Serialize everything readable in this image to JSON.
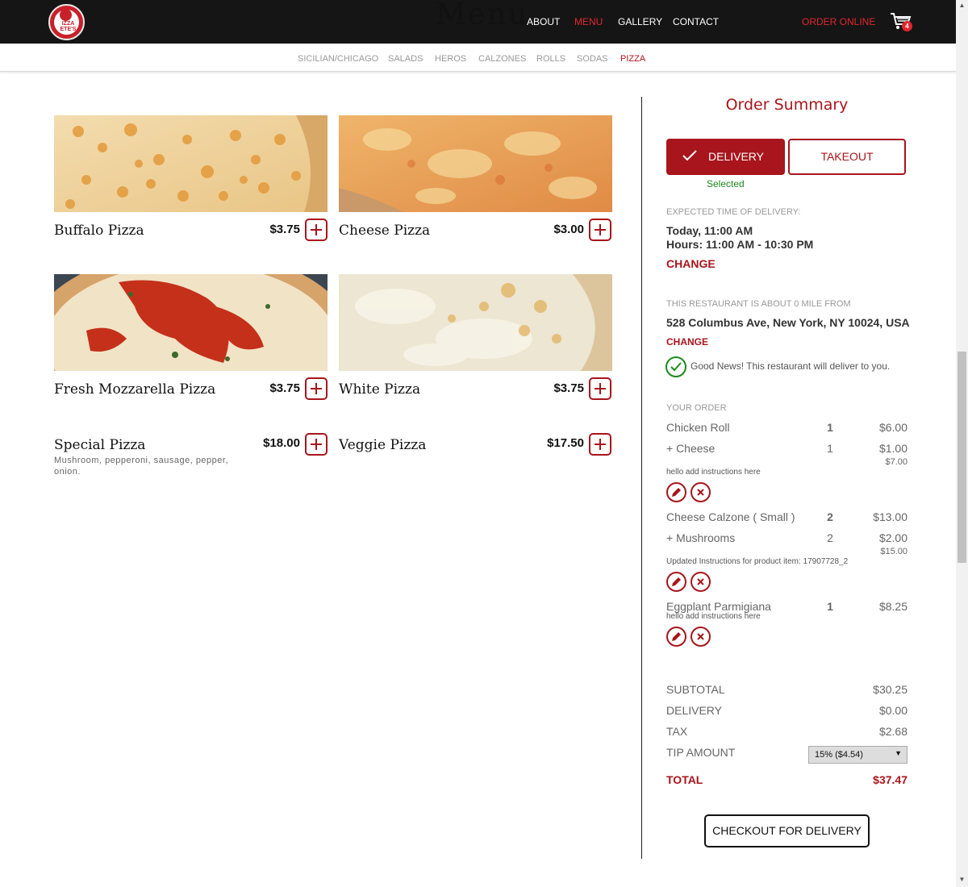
{
  "header": {
    "logo_text": "IZZA ETE'S",
    "page_title": "Menu",
    "nav": [
      "ABOUT",
      "MENU",
      "GALLERY",
      "CONTACT"
    ],
    "order_online": "ORDER ONLINE",
    "cart_count": "4"
  },
  "categories": [
    "SICILIAN/CHICAGO",
    "SALADS",
    "HEROS",
    "CALZONES",
    "ROLLS",
    "SODAS",
    "PIZZA"
  ],
  "active_category": "PIZZA",
  "products": [
    {
      "name": "Buffalo Pizza",
      "price": "$3.75"
    },
    {
      "name": "Cheese Pizza",
      "price": "$3.00"
    },
    {
      "name": "Fresh Mozzarella Pizza",
      "price": "$3.75"
    },
    {
      "name": "White Pizza",
      "price": "$3.75"
    },
    {
      "name": "Special Pizza",
      "price": "$18.00",
      "description": "Mushroom, pepperoni, sausage, pepper, onion."
    },
    {
      "name": "Veggie Pizza",
      "price": "$17.50"
    }
  ],
  "summary": {
    "title": "Order Summary",
    "delivery_label": "DELIVERY",
    "takeout_label": "TAKEOUT",
    "selected": "Selected",
    "expected_label": "EXPECTED TIME OF DELIVERY:",
    "expected_time": "Today, 11:00 AM",
    "hours": "Hours: 11:00 AM - 10:30 PM",
    "change": "CHANGE",
    "distance_label": "THIS RESTAURANT IS ABOUT 0 MILE FROM",
    "address": "528 Columbus Ave, New York, NY 10024, USA",
    "change2": "CHANGE",
    "good_news": "Good News! This restaurant will deliver to you.",
    "your_order_label": "YOUR ORDER",
    "items": [
      {
        "name": "Chicken Roll",
        "qty": "1",
        "price": "$6.00",
        "addon": {
          "name": "+ Cheese",
          "qty": "1",
          "price": "$1.00"
        },
        "item_total": "$7.00",
        "note": "hello add instructions here"
      },
      {
        "name": "Cheese Calzone ( Small )",
        "qty": "2",
        "price": "$13.00",
        "addon": {
          "name": "+ Mushrooms",
          "qty": "2",
          "price": "$2.00"
        },
        "item_total": "$15.00",
        "note": "Updated Instructions for product item: 17907728_2"
      },
      {
        "name": "Eggplant Parmigiana",
        "qty": "1",
        "price": "$8.25",
        "note": "hello add instructions here"
      }
    ],
    "subtotal_label": "SUBTOTAL",
    "subtotal": "$30.25",
    "delivery_fee_label": "DELIVERY",
    "delivery_fee": "$0.00",
    "tax_label": "TAX",
    "tax": "$2.68",
    "tip_label": "TIP AMOUNT",
    "tip_selected": "15% ($4.54)",
    "total_label": "TOTAL",
    "total": "$37.47",
    "checkout": "CHECKOUT FOR DELIVERY"
  },
  "colors": {
    "brand_red": "#a8151c",
    "nav_red": "#e0262f",
    "success_green": "#1c8a1c",
    "topbar": "#151515"
  }
}
